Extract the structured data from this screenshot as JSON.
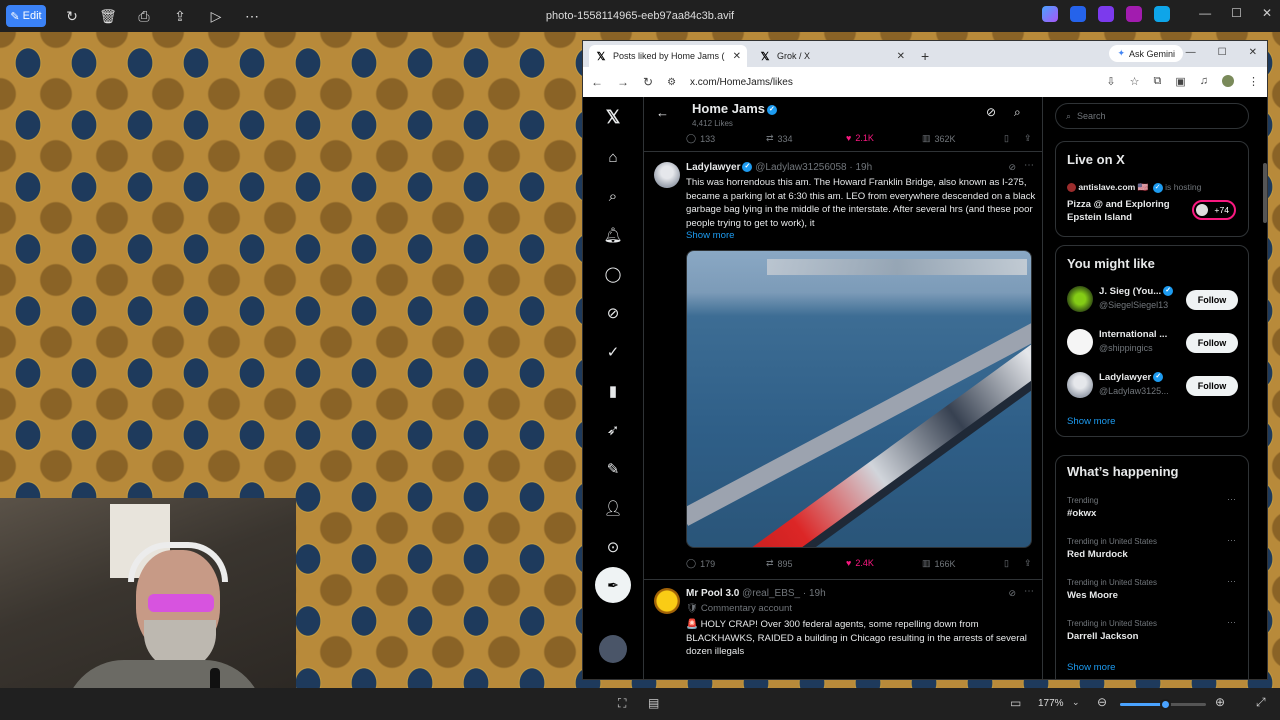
{
  "viewer": {
    "edit_label": "Edit",
    "file_name": "photo-1558114965-eeb97aa84c3b.avif",
    "zoom": "177%",
    "zoom_level": 0.52
  },
  "browser": {
    "tabs": [
      {
        "label": "Posts liked by Home Jams (@H",
        "active": true
      },
      {
        "label": "Grok / X",
        "active": false
      }
    ],
    "gemini_label": "Ask Gemini",
    "url": "x.com/HomeJams/likes"
  },
  "profile": {
    "name": "Home Jams",
    "likes": "4,412 Likes"
  },
  "top_actions": {
    "replies": "133",
    "reposts": "334",
    "likes": "2.1K",
    "views": "362K"
  },
  "posts": [
    {
      "name": "Ladylawyer",
      "handle": "@Ladylaw31256058 · 19h",
      "text": "This was horrendous this am.  The Howard Franklin Bridge, also known as I-275, became a parking lot at 6:30 this am.  LEO from everywhere descended on a black garbage bag lying in the middle of the interstate.  After several hrs (and these poor people trying to get to work), it",
      "show_more": "Show more",
      "replies": "179",
      "reposts": "895",
      "likes": "2.4K",
      "views": "166K"
    },
    {
      "name": "Mr Pool 3.0",
      "handle": "@real_EBS_ · 19h",
      "account_label": "Commentary account",
      "text": "🚨 HOLY CRAP! Over 300 federal agents, some repelling down from BLACKHAWKS, RAIDED a building in Chicago resulting in the arrests of several dozen illegals"
    }
  ],
  "sidebar": {
    "search_placeholder": "Search",
    "live": {
      "title": "Live on X",
      "host": "antislave.com 🇺🇸",
      "hosting": "is hosting",
      "topic": "Pizza @ and Exploring Epstein Island",
      "listeners": "+74"
    },
    "suggestions": {
      "title": "You might like",
      "items": [
        {
          "name": "J. Sieg (You...",
          "handle": "@SiegelSiegel13",
          "button": "Follow"
        },
        {
          "name": "International ...",
          "handle": "@shippingics",
          "button": "Follow"
        },
        {
          "name": "Ladylawyer",
          "handle": "@Ladylaw3125...",
          "button": "Follow"
        }
      ],
      "show_more": "Show more"
    },
    "trends": {
      "title": "What’s happening",
      "items": [
        {
          "context": "Trending",
          "name": "#okwx"
        },
        {
          "context": "Trending in United States",
          "name": "Red Murdock"
        },
        {
          "context": "Trending in United States",
          "name": "Wes Moore"
        },
        {
          "context": "Trending in United States",
          "name": "Darrell Jackson"
        }
      ],
      "show_more": "Show more"
    }
  },
  "colors": {
    "accent": "#1d9bf0",
    "like": "#f91880",
    "x_bg": "#000000"
  }
}
